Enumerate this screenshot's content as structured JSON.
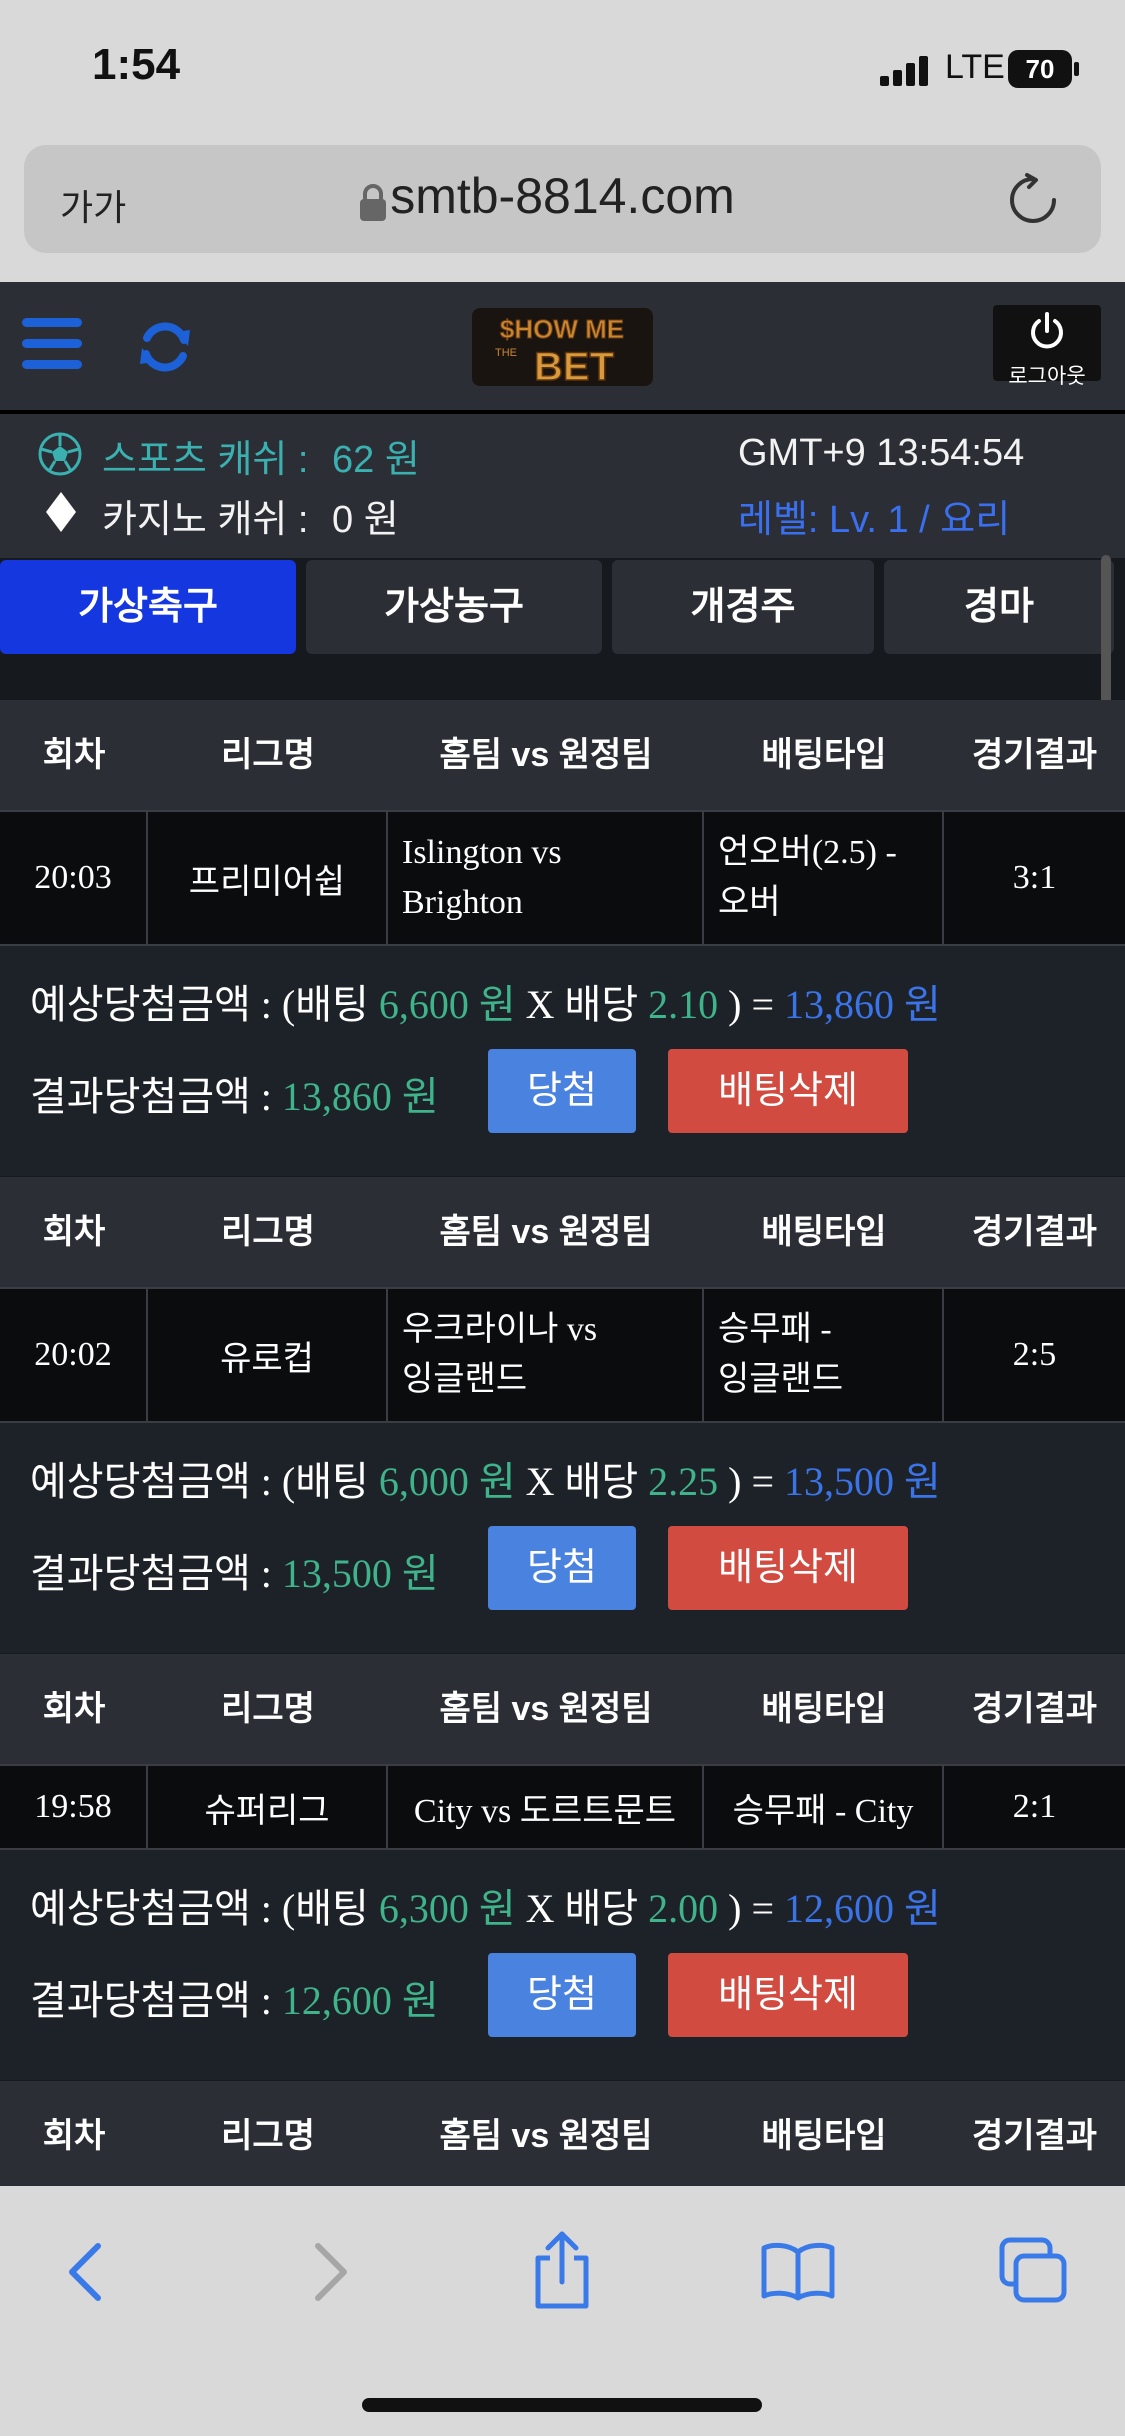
{
  "status_bar": {
    "time": "1:54",
    "network": "LTE",
    "battery": "70"
  },
  "browser": {
    "text_size": "가가",
    "url": "smtb-8814.com"
  },
  "header": {
    "logout_label": "로그아웃",
    "logo_text": "SHOW ME THE BET"
  },
  "info": {
    "sports_cash_label": "스포츠 캐쉬 :",
    "sports_cash_value": "62 원",
    "casino_cash_label": "카지노 캐쉬 :",
    "casino_cash_value": "0 원",
    "clock": "GMT+9 13:54:54",
    "level": "레벨: Lv. 1 / 요리"
  },
  "tabs": [
    "가상축구",
    "가상농구",
    "개경주",
    "경마"
  ],
  "table_headers": [
    "회차",
    "리그명",
    "홈팀 vs 원정팀",
    "배팅타입",
    "경기결과"
  ],
  "labels": {
    "expected": "예상당첨금액 : (배팅",
    "multiply": "X 배당",
    "result": "결과당첨금액 :",
    "win_button": "당첨",
    "delete_button": "배팅삭제"
  },
  "bets": [
    {
      "round": "20:03",
      "league": "프리미어쉽",
      "teams_line1": "Islington vs",
      "teams_line2": "Brighton",
      "type_line1": "언오버(2.5) -",
      "type_line2": "오버",
      "score": "3:1",
      "stake": "6,600 원",
      "odds": "2.10",
      "payout": "13,860 원",
      "result": "13,860 원"
    },
    {
      "round": "20:02",
      "league": "유로컵",
      "teams_line1": "우크라이나 vs",
      "teams_line2": "잉글랜드",
      "type_line1": "승무패 -",
      "type_line2": "잉글랜드",
      "score": "2:5",
      "stake": "6,000 원",
      "odds": "2.25",
      "payout": "13,500 원",
      "result": "13,500 원"
    },
    {
      "round": "19:58",
      "league": "슈퍼리그",
      "teams_line1": "City vs 도르트문트",
      "teams_line2": "",
      "type_line1": "승무패 - City",
      "type_line2": "",
      "score": "2:1",
      "stake": "6,300 원",
      "odds": "2.00",
      "payout": "12,600 원",
      "result": "12,600 원"
    }
  ],
  "colors": {
    "accent_blue": "#1537e0",
    "win_button": "#4a82e0",
    "delete_button": "#d24b40",
    "green_amount": "#3fb38a",
    "blue_amount": "#3b73e8"
  }
}
